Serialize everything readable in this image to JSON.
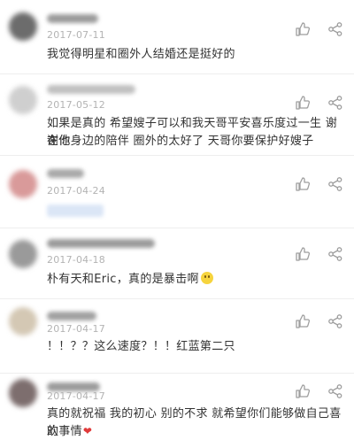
{
  "comments": [
    {
      "date": "2017-07-11",
      "text": "我觉得明星和圈外人结婚还是挺好的"
    },
    {
      "date": "2017-05-12",
      "text_line1": "如果是真的 希望嫂子可以和我天哥平安喜乐度过一生 谢谢你",
      "text_line2": "在他身边的陪伴 圈外的太好了 天哥你要保护好嫂子"
    },
    {
      "date": "2017-04-24"
    },
    {
      "date": "2017-04-18",
      "text": "朴有天和Eric，真的是暴击啊",
      "emoji": "smiling-emoji"
    },
    {
      "date": "2017-04-17",
      "text": "！！？？这么速度？！！红蓝第二只"
    },
    {
      "date": "2017-04-17",
      "text_line1": "真的就祝福 我的初心 别的不求 就希望你们能够做自己喜欢",
      "text_line2": "的事情",
      "emoji": "heart-emoji"
    }
  ],
  "icons": {
    "like": "thumbs-up-icon",
    "share": "share-icon"
  },
  "colors": {
    "text": "#333333",
    "date": "#b3b3b3",
    "icon": "#9e9e9e",
    "divider": "#eeeeee",
    "heart": "#e03a3a"
  }
}
